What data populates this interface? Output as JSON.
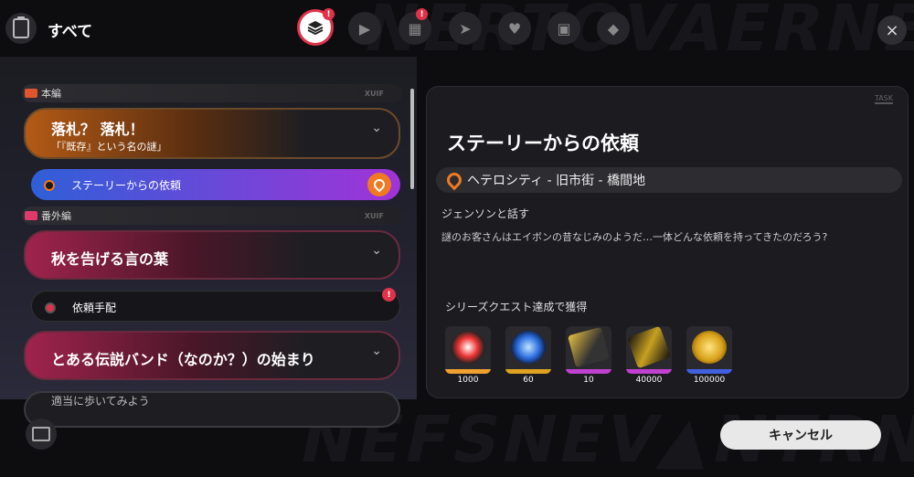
{
  "header": {
    "title": "すべて",
    "tabs": [
      {
        "icon": "layers-icon",
        "active": true,
        "badge": "!"
      },
      {
        "icon": "tv-icon",
        "active": false,
        "badge": ""
      },
      {
        "icon": "film-icon",
        "active": false,
        "badge": "!"
      },
      {
        "icon": "send-icon",
        "active": false,
        "badge": ""
      },
      {
        "icon": "heart-hand-icon",
        "active": false,
        "badge": ""
      },
      {
        "icon": "ticket-icon",
        "active": false,
        "badge": ""
      },
      {
        "icon": "bangboo-icon",
        "active": false,
        "badge": ""
      }
    ],
    "close_label": "×"
  },
  "sections": [
    {
      "label": "本編",
      "tag": "XUIF"
    },
    {
      "label": "番外編",
      "tag": "XUIF"
    }
  ],
  "quests": [
    {
      "title": "落札？ 落札！",
      "subtitle": "「『既存』という名の謎」",
      "chevron": "⌄"
    },
    {
      "title": "秋を告げる言の葉",
      "chevron": "⌄"
    },
    {
      "title": "とある伝説バンド（なのか？）の始まり",
      "chevron": "⌄"
    },
    {
      "title": "適当に歩いてみよう"
    }
  ],
  "subquests": [
    {
      "label": "ステーリーからの依頼",
      "selected": true
    },
    {
      "label": "依頼手配",
      "selected": false,
      "badge": "!"
    }
  ],
  "detail": {
    "tag": "TASK",
    "title": "ステーリーからの依頼",
    "location": "ヘテロシティ - 旧市街 - 橋間地",
    "objective": "ジェンソンと話す",
    "description": "謎のお客さんはエイボンの昔なじみのようだ…一体どんな依頼を持ってきたのだろう?",
    "rewards_header": "シリーズクエスト達成で獲得",
    "rewards": [
      {
        "icon": "inter-knot-credit-icon",
        "count": "1000",
        "rarity_color": "#f0a030"
      },
      {
        "icon": "crystal-orb-icon",
        "count": "60",
        "rarity_color": "#e0a020"
      },
      {
        "icon": "w-engine-material-icon",
        "count": "10",
        "rarity_color": "#c040d0"
      },
      {
        "icon": "ticket-material-icon",
        "count": "40000",
        "rarity_color": "#c040d0"
      },
      {
        "icon": "dennies-coin-icon",
        "count": "100000",
        "rarity_color": "#4060e0"
      }
    ]
  },
  "footer": {
    "cancel_label": "キャンセル"
  },
  "colors": {
    "accent_red": "#e0334a",
    "accent_orange": "#f07a22",
    "selected_gradient": [
      "#2f5fd8",
      "#a133d8"
    ]
  }
}
